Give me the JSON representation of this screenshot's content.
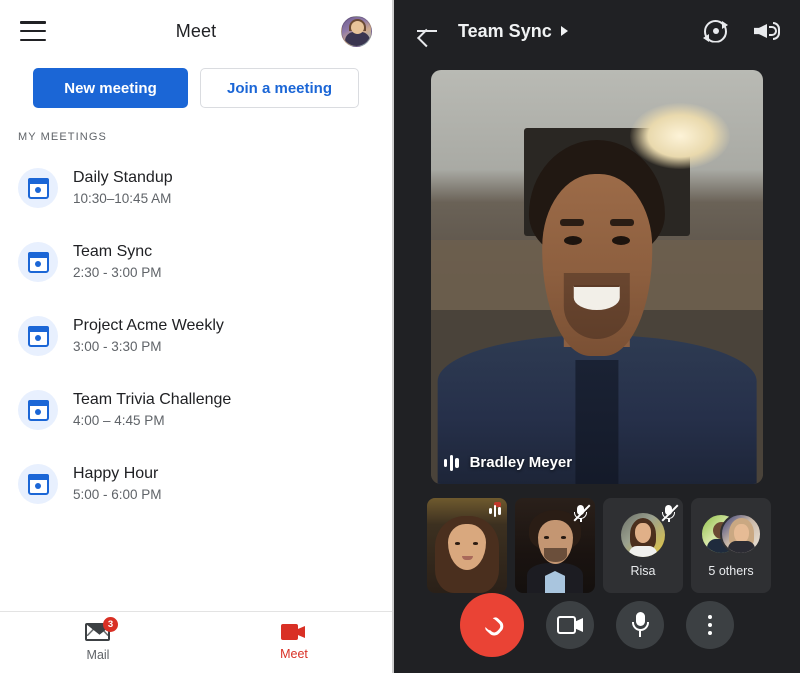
{
  "left": {
    "header": {
      "menu_icon": "hamburger-icon",
      "title": "Meet",
      "avatar_icon": "user-avatar"
    },
    "buttons": {
      "new_meeting": "New meeting",
      "join_meeting": "Join a meeting"
    },
    "section_label": "MY MEETINGS",
    "meetings": [
      {
        "title": "Daily Standup",
        "time": "10:30–10:45 AM",
        "icon": "calendar-icon"
      },
      {
        "title": "Team Sync",
        "time": "2:30 - 3:00 PM",
        "icon": "calendar-icon"
      },
      {
        "title": "Project Acme Weekly",
        "time": "3:00 - 3:30 PM",
        "icon": "calendar-icon"
      },
      {
        "title": "Team Trivia Challenge",
        "time": "4:00 – 4:45 PM",
        "icon": "calendar-icon"
      },
      {
        "title": "Happy Hour",
        "time": "5:00 - 6:00 PM",
        "icon": "calendar-icon"
      }
    ],
    "bottom_nav": [
      {
        "label": "Mail",
        "icon": "mail-icon",
        "badge": "3",
        "active": false
      },
      {
        "label": "Meet",
        "icon": "video-camera-icon",
        "badge": "",
        "active": true
      }
    ]
  },
  "right": {
    "header": {
      "back_icon": "back-arrow-icon",
      "title": "Team Sync",
      "caret_icon": "caret-right-icon",
      "flip_camera_icon": "flip-camera-icon",
      "speaker_icon": "speaker-icon"
    },
    "main_video": {
      "participant_name": "Bradley Meyer",
      "audio_icon": "audio-level-icon"
    },
    "tiles": [
      {
        "name": "",
        "type": "video",
        "status_icon": "audio-level-icon"
      },
      {
        "name": "",
        "type": "video",
        "status_icon": "mic-muted-icon"
      },
      {
        "name": "Risa",
        "type": "avatar",
        "status_icon": "mic-muted-icon"
      },
      {
        "name": "5 others",
        "type": "avatar-stack",
        "status_icon": ""
      }
    ],
    "controls": [
      {
        "label": "End call",
        "icon": "hangup-icon",
        "color": "#ea4335"
      },
      {
        "label": "Camera",
        "icon": "video-camera-icon",
        "color": "#3c4043"
      },
      {
        "label": "Microphone",
        "icon": "microphone-icon",
        "color": "#3c4043"
      },
      {
        "label": "More options",
        "icon": "more-vertical-icon",
        "color": "#3c4043"
      }
    ]
  },
  "colors": {
    "primary_blue": "#1b66d6",
    "accent_red": "#d93025",
    "hangup_red": "#ea4335",
    "dark_bg": "#202124"
  }
}
